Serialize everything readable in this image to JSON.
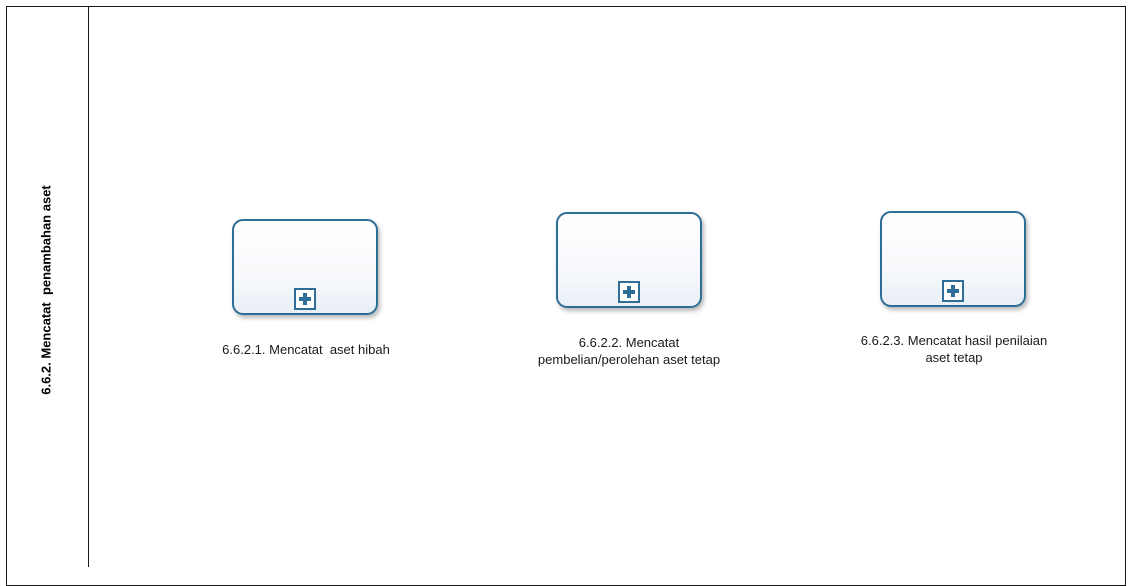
{
  "lane": {
    "title": "6.6.2. Mencatat  penambahan aset"
  },
  "tasks": [
    {
      "label_line1": "6.6.2.1. Mencatat  aset hibah",
      "label_line2": ""
    },
    {
      "label_line1": "6.6.2.2. Mencatat",
      "label_line2": "pembelian/perolehan aset tetap"
    },
    {
      "label_line1": "6.6.2.3. Mencatat hasil penilaian",
      "label_line2": "aset tetap"
    }
  ],
  "colors": {
    "task_border": "#2e6e96",
    "lines": "#1a1a1a"
  },
  "icons": {
    "subprocess_marker": "plus-square-icon"
  }
}
